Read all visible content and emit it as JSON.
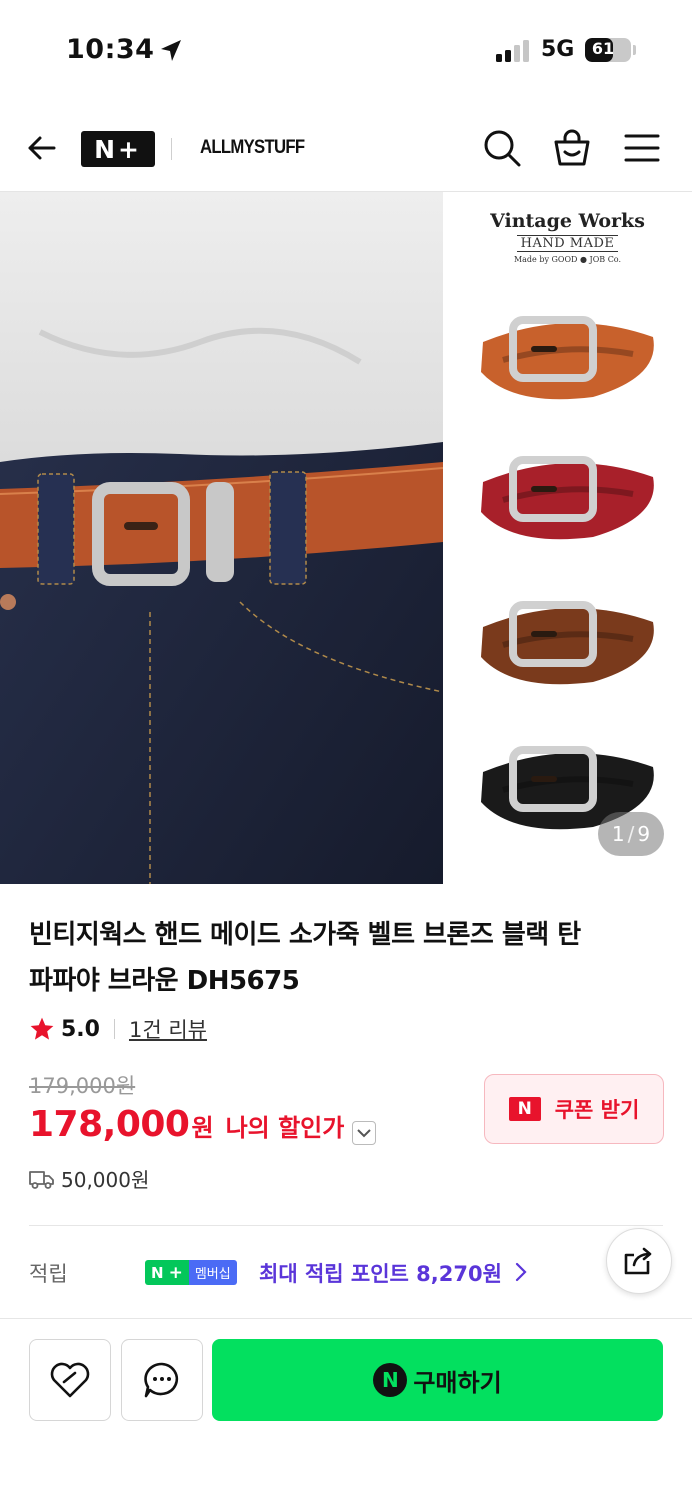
{
  "status_bar": {
    "time": "10:34",
    "network": "5G",
    "battery": "61",
    "battery_level": 0.61
  },
  "header": {
    "logo": "N+",
    "store_name": "ALLMYSTUFF"
  },
  "gallery": {
    "brand_title": "Vintage Works",
    "brand_subtitle": "HAND MADE",
    "brand_maker": "Made by GOOD ● JOB Co.",
    "current": "1",
    "total": "9",
    "variant_colors": [
      "#c8612c",
      "#a8202a",
      "#7a3a1c",
      "#1a1a1a"
    ]
  },
  "product": {
    "title_line1": "빈티지웍스 핸드 메이드 소가죽 벨트 브론즈 블랙 탄",
    "title_line2": "파파야 브라운 DH5675",
    "rating": "5.0",
    "reviews": "1건 리뷰",
    "original_price": "179,000원",
    "sale_price": "178,000",
    "sale_unit": "원",
    "my_price_label": "나의 할인가",
    "coupon_label": "쿠폰 받기",
    "coupon_badge": "N",
    "shipping_fee": "50,000원"
  },
  "points": {
    "label": "적립",
    "membership_badge": "멤버십",
    "text": "최대 적립 포인트 8,270원"
  },
  "bottom_bar": {
    "buy_label": "구매하기",
    "buy_badge": "N"
  },
  "colors": {
    "sale_red": "#e8132c",
    "naver_green": "#03e05f",
    "points_purple": "#5a35d9"
  }
}
